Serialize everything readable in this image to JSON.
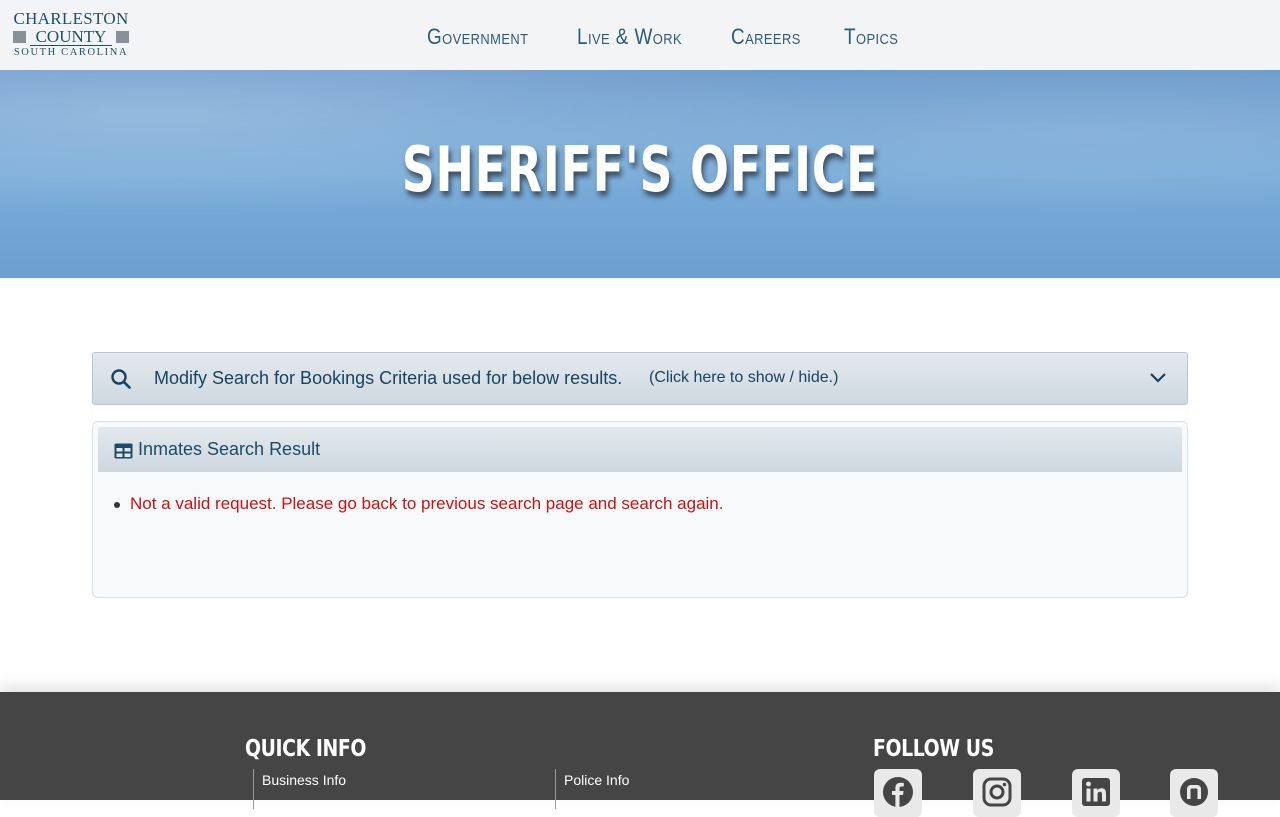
{
  "logo": {
    "line1": "CHARLESTON",
    "line2": "COUNTY",
    "line3": "SOUTH CAROLINA"
  },
  "nav": {
    "items": [
      {
        "label": "Government"
      },
      {
        "label": "Live & Work"
      },
      {
        "label": "Careers"
      },
      {
        "label": "Topics"
      }
    ]
  },
  "banner": {
    "title": "SHERIFF'S OFFICE"
  },
  "search": {
    "title": "Modify Search for Bookings Criteria used for below results.",
    "hint": "(Click here to show / hide.)",
    "icon": "search-icon",
    "toggle_icon": "chevron-down-icon"
  },
  "results": {
    "title": "Inmates Search Result",
    "icon": "table-icon",
    "errors": [
      "Not a valid request. Please go back to previous search page and search again."
    ]
  },
  "footer": {
    "quick_info": "QUICK INFO",
    "follow_us": "FOLLOW US",
    "links": [
      "Business Info",
      "Police Info"
    ],
    "social": [
      "facebook-icon",
      "instagram-icon",
      "linkedin-icon",
      "nextdoor-icon"
    ]
  },
  "colors": {
    "accent": "#2d5a7b",
    "error": "#cc1111",
    "footer_bg": "#454545"
  }
}
